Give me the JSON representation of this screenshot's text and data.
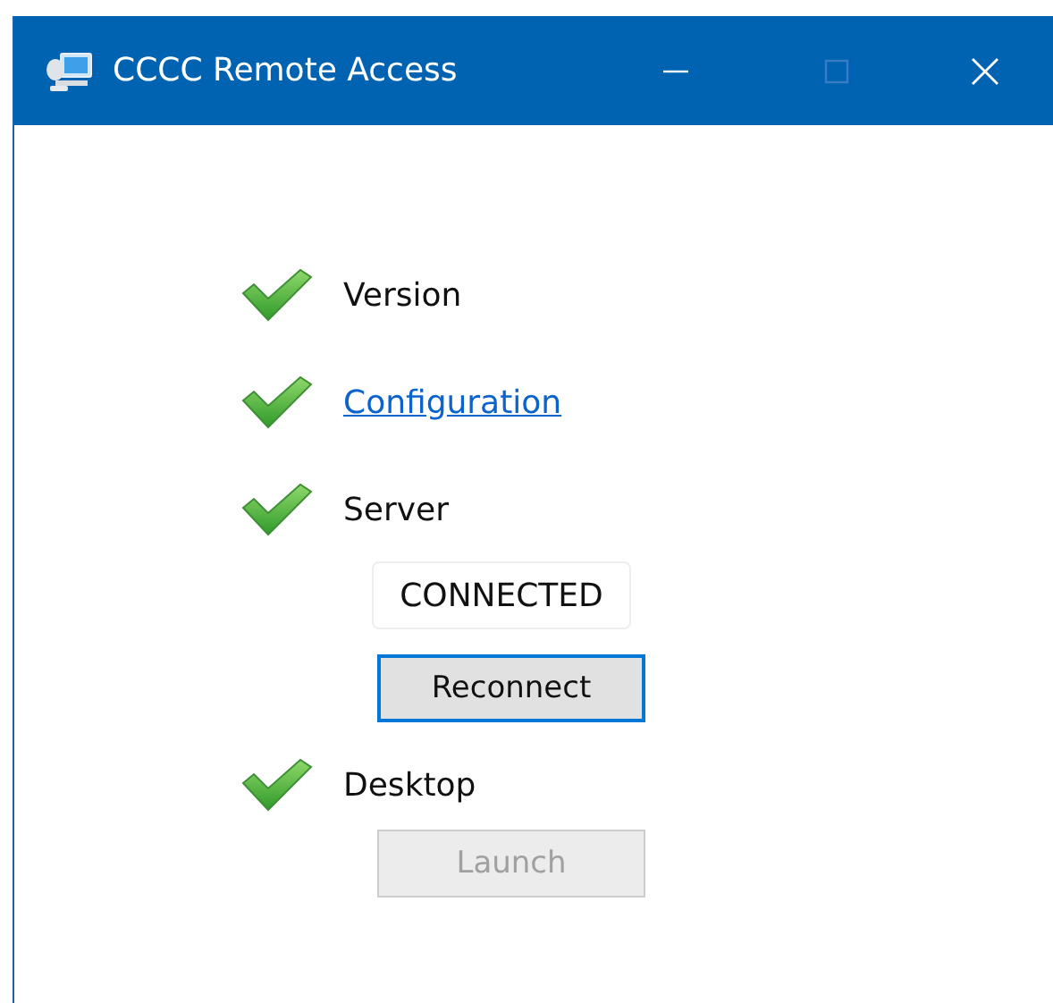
{
  "window": {
    "title": "CCCC Remote Access",
    "maximize_disabled": true
  },
  "checks": [
    {
      "label": "Version",
      "kind": "text",
      "ok": true
    },
    {
      "label": "Configuration",
      "kind": "link",
      "ok": true
    },
    {
      "label": "Server",
      "kind": "text",
      "ok": true,
      "status": "CONNECTED",
      "button": {
        "label": "Reconnect",
        "disabled": false,
        "focused": true
      }
    },
    {
      "label": "Desktop",
      "kind": "text",
      "ok": true,
      "button": {
        "label": "Launch",
        "disabled": true,
        "focused": false
      }
    }
  ]
}
